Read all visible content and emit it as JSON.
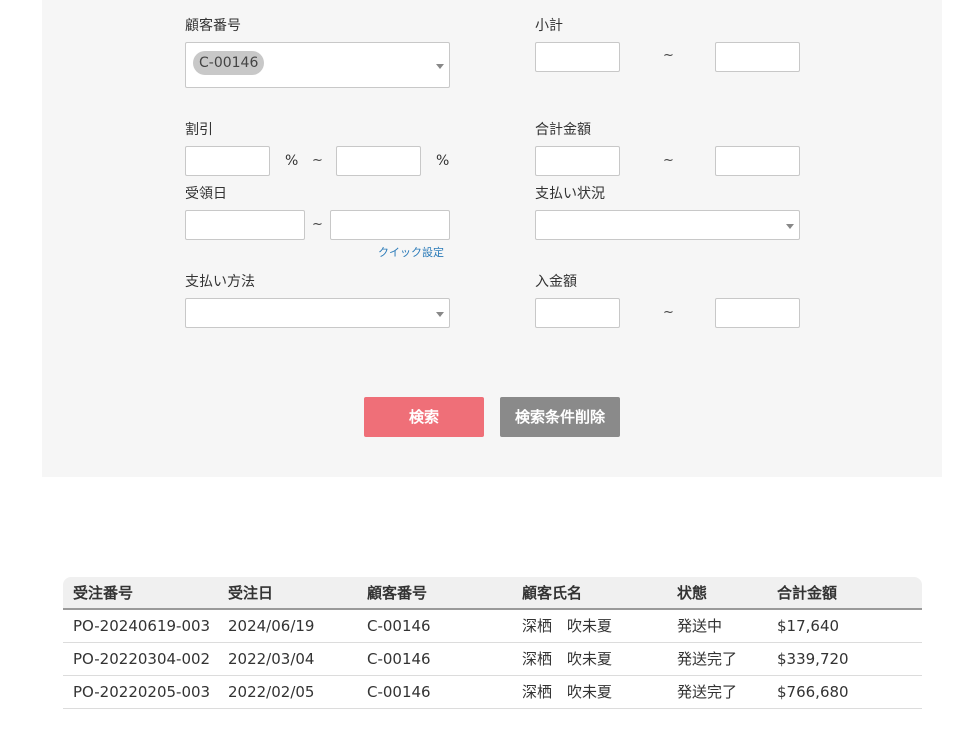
{
  "form": {
    "customer_no": {
      "label": "顧客番号",
      "selected": "C-00146"
    },
    "subtotal": {
      "label": "小計",
      "separator": "~"
    },
    "discount": {
      "label": "割引",
      "unit": "%",
      "separator": "~"
    },
    "total_amount": {
      "label": "合計金額",
      "separator": "~"
    },
    "received_date": {
      "label": "受領日",
      "separator": "~",
      "quick_setting": "クイック設定"
    },
    "payment_status": {
      "label": "支払い状況"
    },
    "payment_method": {
      "label": "支払い方法"
    },
    "deposit_amount": {
      "label": "入金額",
      "separator": "~"
    },
    "search_button": "検索",
    "clear_button": "検索条件削除"
  },
  "table": {
    "headers": [
      "受注番号",
      "受注日",
      "顧客番号",
      "顧客氏名",
      "状態",
      "合計金額"
    ],
    "rows": [
      [
        "PO-20240619-003",
        "2024/06/19",
        "C-00146",
        "深栖　吹未夏",
        "発送中",
        "$17,640"
      ],
      [
        "PO-20220304-002",
        "2022/03/04",
        "C-00146",
        "深栖　吹未夏",
        "発送完了",
        "$339,720"
      ],
      [
        "PO-20220205-003",
        "2022/02/05",
        "C-00146",
        "深栖　吹未夏",
        "発送完了",
        "$766,680"
      ]
    ]
  },
  "colors": {
    "search_button": "#ef6f78",
    "clear_button": "#8a8a8a",
    "panel_bg": "#f6f6f6",
    "link": "#2a7ab8"
  }
}
